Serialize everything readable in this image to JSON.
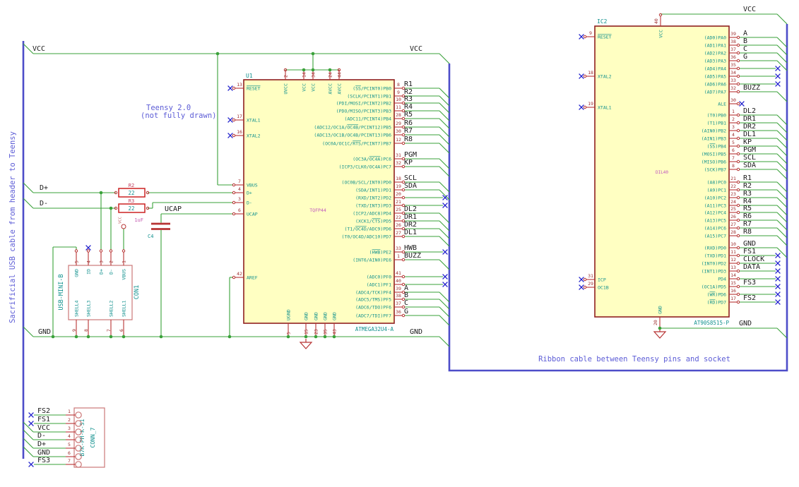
{
  "colors": {
    "wire": "#3aa13a",
    "bus": "#4d4dc9",
    "pin": "#b73333",
    "outline": "#8f1f1f",
    "fill": "#ffffc2",
    "num": "#9e2f2f",
    "name": "#12918e",
    "label": "#1a1a1a",
    "note": "#5c5cd6",
    "nc": "#2020cc",
    "res": "#cc2222",
    "resref": "#c34262",
    "capval": "#c45ab0",
    "footprint": "#bf55bf",
    "connbox": "#cc7777"
  },
  "notes": {
    "usb_cable": "Sacrificial USB cable from header to Teensy",
    "teensy_line1": "Teensy 2.0",
    "teensy_line2": "(not fully drawn)",
    "ribbon": "Ribbon cable between Teensy pins and socket"
  },
  "net_labels": {
    "vcc": "VCC",
    "gnd": "GND",
    "dplus": "D+",
    "dminus": "D-",
    "ucap": "UCAP"
  },
  "power_flag": "VCC",
  "u1": {
    "ref": "U1",
    "value": "ATMEGA32U4-A",
    "footprint": "TQFP44",
    "left_pins": [
      [
        "13",
        "{RESET}",
        125,
        "nc"
      ],
      [
        "17",
        "XTAL1",
        170,
        "nc"
      ],
      [
        "16",
        "XTAL2",
        192,
        "nc"
      ],
      [
        "7",
        "VBUS",
        262,
        "wire"
      ],
      [
        "4",
        "D+",
        273,
        "wire"
      ],
      [
        "3",
        "D-",
        287,
        "wire"
      ],
      [
        "6",
        "UCAP",
        303,
        "wire"
      ],
      [
        "42",
        "AREF",
        393,
        "wire"
      ]
    ],
    "right_pins": [
      [
        "8",
        "({SS}/PCINT0)PB0",
        "R1",
        "bus",
        125
      ],
      [
        "9",
        "(SCLK/PCINT1)PB1",
        "R2",
        "bus",
        136
      ],
      [
        "10",
        "(PDI/MOSI/PCINT2)PB2",
        "R3",
        "bus",
        146
      ],
      [
        "11",
        "(PDO/MISO/PCINT3)PB3",
        "R4",
        "bus",
        157
      ],
      [
        "28",
        "(ADC11/PCINT4)PB4",
        "R5",
        "bus",
        168
      ],
      [
        "29",
        "(ADC12/OC1A/{OC4B}/PCINT12)PB5",
        "R6",
        "bus",
        180
      ],
      [
        "30",
        "(ADC13/OC1B/OC4B/PCINT13)PB6",
        "R7",
        "bus",
        191
      ],
      [
        "12",
        "(OC0A/OC1C/{RTS}/PCINT7)PB7",
        "R8",
        "bus",
        203
      ],
      [
        "31",
        "(OC3A/{OC4A})PC6",
        "PGM",
        "bus",
        225
      ],
      [
        "32",
        "(ICP3/CLK0/OC4A)PC7",
        "KP",
        "bus",
        236
      ],
      [
        "18",
        "(OC0B/SCL/INT0)PD0",
        "SCL",
        "bus",
        258
      ],
      [
        "19",
        "(SDA/INT1)PD1",
        "SDA",
        "bus",
        269
      ],
      [
        "20",
        "(RXD/INT2)PD2",
        "",
        "nc",
        280
      ],
      [
        "21",
        "(TXD/INT3)PD3",
        "",
        "nc",
        291
      ],
      [
        "25",
        "(ICP2/ADC8)PD4",
        "DL2",
        "bus",
        302
      ],
      [
        "22",
        "(XCK1/{CTS})PD5",
        "DR1",
        "bus",
        313
      ],
      [
        "26",
        "(T1/{OC4D}/ADC9)PD6",
        "DR2",
        "bus",
        324
      ],
      [
        "27",
        "(T0/OC4D/ADC10)PD7",
        "DL1",
        "bus",
        335
      ],
      [
        "33",
        "({HWB})PE2",
        "HWB",
        "nc",
        357
      ],
      [
        "1",
        "(INT6/AIN0)PE6",
        "BUZZ",
        "bus",
        368
      ],
      [
        "41",
        "(ADC0)PF0",
        "",
        "nc",
        392
      ],
      [
        "40",
        "(ADC1)PF1",
        "",
        "nc",
        403
      ],
      [
        "39",
        "(ADC4/TCK)PF4",
        "A",
        "bus",
        414
      ],
      [
        "38",
        "(ADC5/TMS)PF5",
        "B",
        "bus",
        424
      ],
      [
        "37",
        "(ADC6/TDO)PF6",
        "C",
        "bus",
        435
      ],
      [
        "36",
        "(ADC7/TDI)PF7",
        "G",
        "bus",
        447
      ]
    ],
    "top_pins": [
      [
        "2",
        "UVCC",
        404
      ],
      [
        "14",
        "VCC",
        430
      ],
      [
        "34",
        "VCC",
        443
      ],
      [
        "24",
        "AVCC",
        467
      ],
      [
        "44",
        "AVCC",
        480
      ]
    ],
    "bottom_pins": [
      [
        "5",
        "UGND",
        408
      ],
      [
        "15",
        "GND",
        433
      ],
      [
        "23",
        "GND",
        447
      ],
      [
        "35",
        "GND",
        460
      ],
      [
        "43",
        "GND",
        473
      ]
    ]
  },
  "ic2": {
    "ref": "IC2",
    "value": "AT90S8515-P",
    "footprint": "DIL40",
    "left_pins": [
      [
        "9",
        "{RESET}",
        52
      ],
      [
        "18",
        "XTAL2",
        108
      ],
      [
        "19",
        "XTAL1",
        152
      ],
      [
        "31",
        "ICP",
        396
      ],
      [
        "29",
        "OC1B",
        407
      ]
    ],
    "top_pin": [
      "40",
      "VCC"
    ],
    "bottom_pin": [
      "20",
      "GND"
    ],
    "right_pins": [
      [
        "39",
        "(AD0)PA0",
        "A",
        "bus",
        53
      ],
      [
        "38",
        "(AD1)PA1",
        "B",
        "bus",
        64
      ],
      [
        "37",
        "(AD2)PA2",
        "C",
        "bus",
        75
      ],
      [
        "36",
        "(AD3)PA3",
        "G",
        "bus",
        86
      ],
      [
        "35",
        "(AD4)PA4",
        "",
        "nc",
        97
      ],
      [
        "34",
        "(AD5)PA5",
        "",
        "nc",
        108
      ],
      [
        "33",
        "(AD6)PA6",
        "",
        "nc",
        119
      ],
      [
        "32",
        "(AD7)PA7",
        "BUZZ",
        "bus",
        130
      ],
      [
        "30",
        "ALE",
        "",
        "ncpin",
        147
      ],
      [
        "1",
        "(T0)PB0",
        "DL2",
        "bus",
        163
      ],
      [
        "2",
        "(T1)PB1",
        "DR1",
        "bus",
        174
      ],
      [
        "3",
        "(AIN0)PB2",
        "DR2",
        "bus",
        185
      ],
      [
        "4",
        "(AIN1)PB3",
        "DL1",
        "bus",
        196
      ],
      [
        "5",
        "({SS})PB4",
        "KP",
        "bus",
        207
      ],
      [
        "6",
        "(MOSI)PB5",
        "PGM",
        "bus",
        218
      ],
      [
        "7",
        "(MISO)PB6",
        "SCL",
        "bus",
        229
      ],
      [
        "8",
        "(SCK)PB7",
        "SDA",
        "bus",
        240
      ],
      [
        "21",
        "(A8)PC0",
        "R1",
        "bus",
        258
      ],
      [
        "22",
        "(A9)PC1",
        "R2",
        "bus",
        269
      ],
      [
        "23",
        "(A10)PC2",
        "R3",
        "bus",
        280
      ],
      [
        "24",
        "(A11)PC3",
        "R4",
        "bus",
        291
      ],
      [
        "25",
        "(A12)PC4",
        "R5",
        "bus",
        301
      ],
      [
        "26",
        "(A13)PC5",
        "R6",
        "bus",
        312
      ],
      [
        "27",
        "(A14)PC6",
        "R7",
        "bus",
        323
      ],
      [
        "28",
        "(A15)PC7",
        "R8",
        "bus",
        334
      ],
      [
        "10",
        "(RXD)PD0",
        "GND",
        "bus",
        351
      ],
      [
        "11",
        "(TXD)PD1",
        "FS1",
        "nc",
        362
      ],
      [
        "12",
        "(INT0)PD2",
        "CLOCK",
        "nc",
        373
      ],
      [
        "13",
        "(INT1)PD3",
        "DATA",
        "nc",
        384
      ],
      [
        "14",
        "PD4",
        "",
        "nc",
        395
      ],
      [
        "15",
        "(OC1A)PD5",
        "FS3",
        "nc",
        406
      ],
      [
        "16",
        "({WR})PD6",
        "",
        "nc",
        417
      ],
      [
        "17",
        "({RD})PD7",
        "FS2",
        "nc",
        428
      ]
    ]
  },
  "con1": {
    "ref": "CON1",
    "value": "USB-MINI-B",
    "top_pins": [
      [
        "5",
        "GND",
        108
      ],
      [
        "4",
        "ID",
        125
      ],
      [
        "3",
        "D+",
        143
      ],
      [
        "2",
        "D-",
        157
      ],
      [
        "1",
        "VBUS",
        175
      ]
    ],
    "bottom_pins": [
      [
        "9",
        "SHELL4",
        108
      ],
      [
        "8",
        "SHELL3",
        125
      ],
      [
        "7",
        "SHELL2",
        157
      ],
      [
        "6",
        "SHELL1",
        175
      ]
    ]
  },
  "conn7": {
    "ref": "CONN_7",
    "value": "B7K-PH-K-S1",
    "pins": [
      [
        "1",
        "FS2",
        "nc"
      ],
      [
        "2",
        "FS1",
        "nc"
      ],
      [
        "3",
        "VCC",
        "bus"
      ],
      [
        "4",
        "D-",
        "bus"
      ],
      [
        "5",
        "D+",
        "bus"
      ],
      [
        "6",
        "GND",
        "bus"
      ],
      [
        "7",
        "FS3",
        "nc"
      ]
    ]
  },
  "r2": {
    "ref": "R2",
    "value": "22"
  },
  "r3": {
    "ref": "R3",
    "value": "22"
  },
  "c4": {
    "ref": "C4",
    "value": "1uF"
  }
}
